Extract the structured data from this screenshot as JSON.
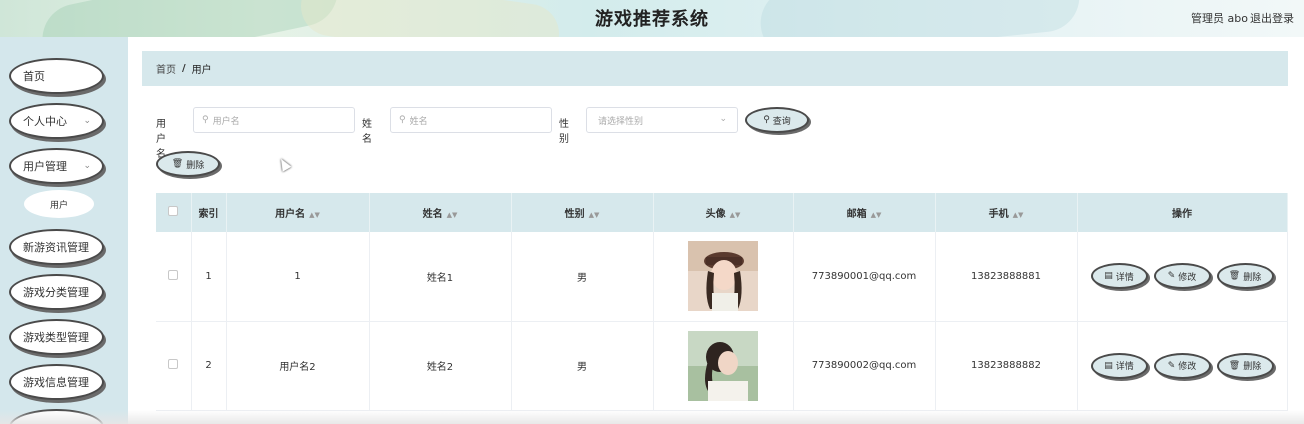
{
  "header": {
    "title": "游戏推荐系统",
    "user_label": "管理员 abo",
    "logout_label": "退出登录"
  },
  "sidebar": {
    "items": [
      {
        "label": "首页",
        "has_arrow": false
      },
      {
        "label": "个人中心",
        "has_arrow": true
      },
      {
        "label": "用户管理",
        "has_arrow": true
      },
      {
        "label": "新游资讯管理",
        "has_arrow": false
      },
      {
        "label": "游戏分类管理",
        "has_arrow": false
      },
      {
        "label": "游戏类型管理",
        "has_arrow": false
      },
      {
        "label": "游戏信息管理",
        "has_arrow": false
      }
    ],
    "sub_item": "用户"
  },
  "breadcrumb": {
    "home": "首页",
    "separator": "/",
    "current": "用户"
  },
  "search": {
    "username_label": "用户名",
    "username_placeholder": "用户名",
    "name_label": "姓名",
    "name_placeholder": "姓名",
    "gender_label": "性别",
    "gender_placeholder": "请选择性别",
    "query_label": "查询",
    "delete_label": "删除"
  },
  "table": {
    "headers": [
      "索引",
      "用户名",
      "姓名",
      "性别",
      "头像",
      "邮箱",
      "手机",
      "操作"
    ],
    "rows": [
      {
        "index": "1",
        "username": "1",
        "name": "姓名1",
        "gender": "男",
        "email": "773890001@qq.com",
        "phone": "13823888881"
      },
      {
        "index": "2",
        "username": "用户名2",
        "name": "姓名2",
        "gender": "男",
        "email": "773890002@qq.com",
        "phone": "13823888882"
      }
    ],
    "actions": {
      "detail": "详情",
      "edit": "修改",
      "delete": "删除"
    }
  },
  "colors": {
    "accent": "#d6e8ec",
    "sidebar_bg": "#d4e7ec",
    "button_bg": "#dbe9ec"
  }
}
